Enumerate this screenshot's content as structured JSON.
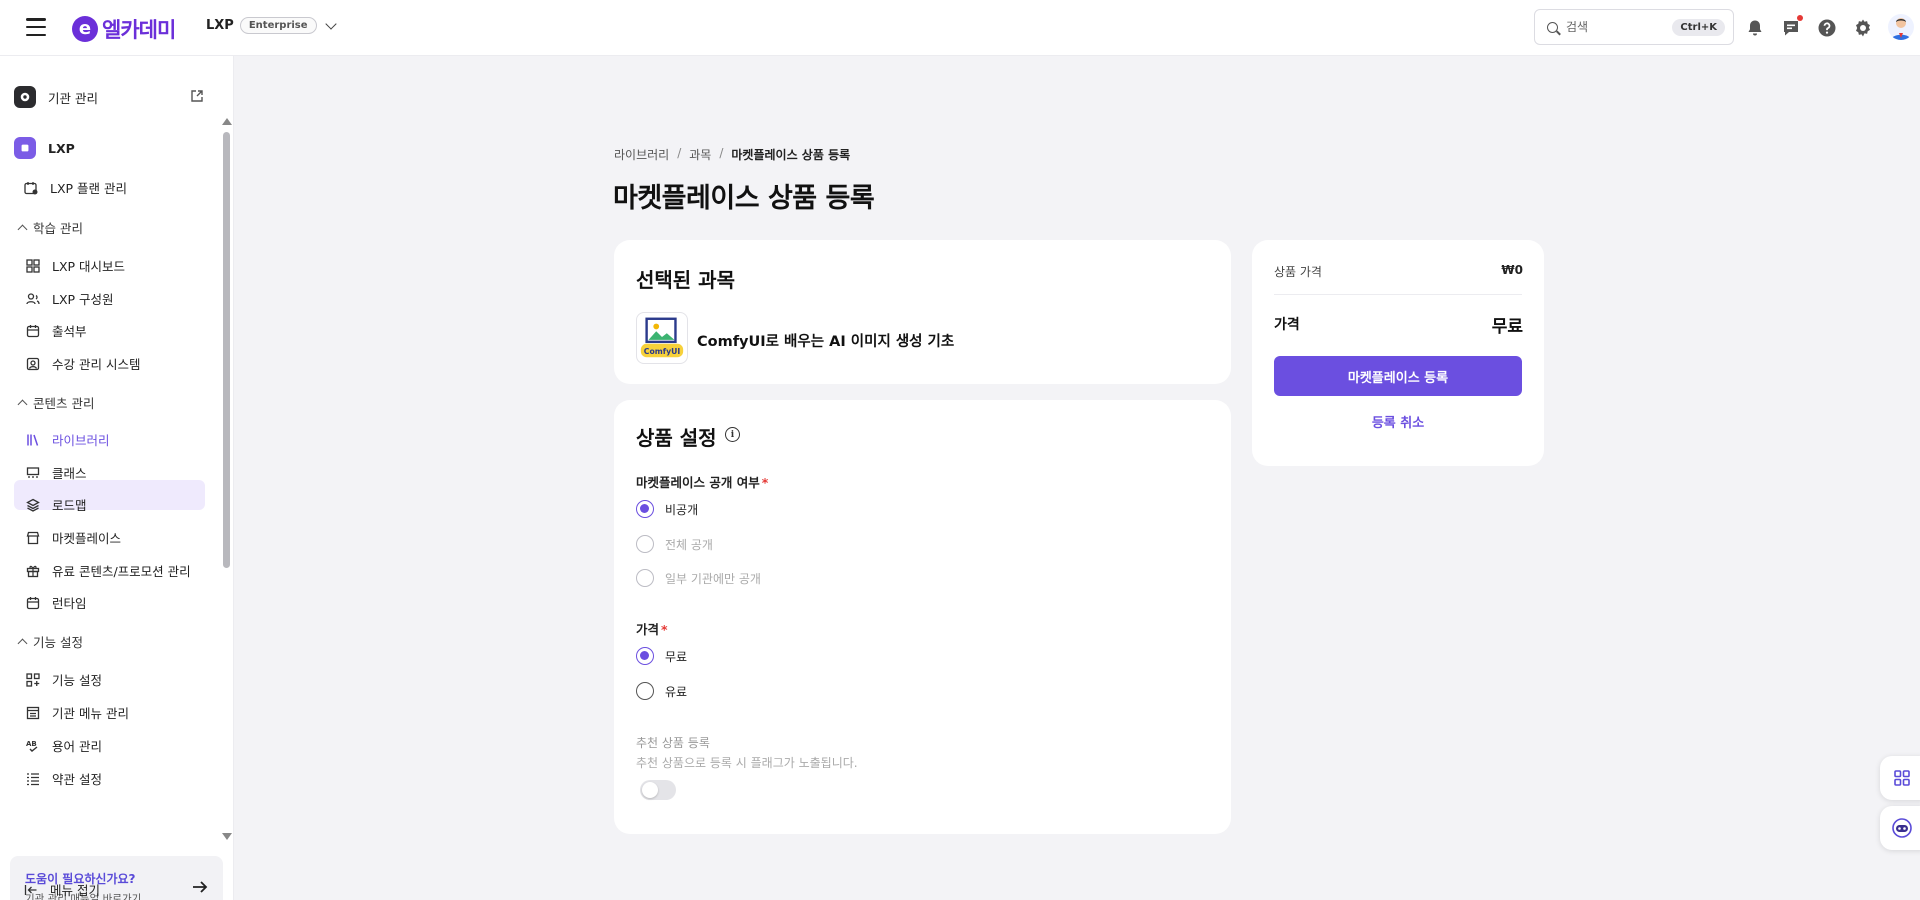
{
  "header": {
    "logo_mark": "e",
    "logo_text": "엘카데미",
    "plan_name": "LXP",
    "plan_badge": "Enterprise",
    "search_placeholder": "검색",
    "search_shortcut": "Ctrl+K"
  },
  "sidebar": {
    "org_admin": "기관 관리",
    "lxp": "LXP",
    "lxp_plan": "LXP 플랜 관리",
    "section_learning": "학습 관리",
    "learning_items": [
      "LXP 대시보드",
      "LXP 구성원",
      "출석부",
      "수강 관리 시스템"
    ],
    "section_content": "콘텐츠 관리",
    "content_items": [
      "라이브러리",
      "클래스",
      "로드맵",
      "마켓플레이스",
      "유료 콘텐츠/프로모션 관리",
      "런타임"
    ],
    "section_feature": "기능 설정",
    "feature_items": [
      "기능 설정",
      "기관 메뉴 관리",
      "용어 관리",
      "약관 설정"
    ],
    "help_title": "도움이 필요하신가요?",
    "help_sub": "기관 관리 매뉴얼 바로가기",
    "collapse": "메뉴 접기"
  },
  "main": {
    "breadcrumb": [
      "라이브러리",
      "과목",
      "마켓플레이스 상품 등록"
    ],
    "breadcrumb_sep": "/",
    "title": "마켓플레이스 상품 등록",
    "selected_card": {
      "title": "선택된 과목",
      "course_name": "ComfyUI로 배우는 AI 이미지 생성 기초",
      "thumb_text": "ComfyUI"
    },
    "settings_card": {
      "title": "상품 설정",
      "info_glyph": "i",
      "visibility_label": "마켓플레이스 공개 여부",
      "required_mark": "*",
      "visibility_options": [
        "비공개",
        "전체 공개",
        "일부 기관에만 공개"
      ],
      "visibility_selected": "비공개",
      "price_label": "가격",
      "price_options": [
        "무료",
        "유료"
      ],
      "price_selected": "무료",
      "recommend_title": "추천 상품 등록",
      "recommend_desc": "추천 상품으로 등록 시 플래그가 노출됩니다.",
      "recommend_enabled": false
    },
    "summary_card": {
      "product_price_label": "상품 가격",
      "product_price_value": "₩0",
      "price_label": "가격",
      "price_value": "무료",
      "register_button": "마켓플레이스 등록",
      "cancel_button": "등록 취소"
    }
  },
  "colors": {
    "accent": "#6b4fe0",
    "brand": "#6b2fd9",
    "required": "#e53935",
    "notification_dot": "#e53935"
  },
  "icons": [
    "hamburger-icon",
    "search-icon",
    "bell-icon",
    "chat-icon",
    "help-icon",
    "gear-icon",
    "external-link-icon",
    "arrow-right-icon",
    "collapse-icon",
    "grid-icon",
    "bot-icon"
  ]
}
